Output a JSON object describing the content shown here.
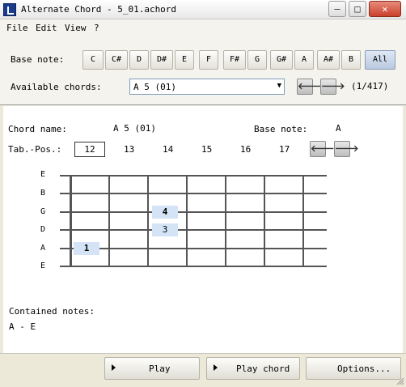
{
  "window": {
    "title": "Alternate Chord - 5_01.achord"
  },
  "menu": [
    "File",
    "Edit",
    "View",
    "?"
  ],
  "base_note": {
    "label": "Base note:",
    "notes": [
      "C",
      "C#",
      "D",
      "D#",
      "E",
      "F",
      "F#",
      "G",
      "G#",
      "A",
      "A#",
      "B"
    ],
    "all_label": "All"
  },
  "available": {
    "label": "Available chords:",
    "selected": "A 5 (01)",
    "counter": "(1/417)"
  },
  "chord": {
    "name_label": "Chord name:",
    "name_value": "A 5 (01)",
    "base_label": "Base note:",
    "base_value": "A",
    "tabpos_label": "Tab.-Pos.:",
    "positions": [
      "12",
      "13",
      "14",
      "15",
      "16",
      "17"
    ]
  },
  "strings": [
    "E",
    "B",
    "G",
    "D",
    "A",
    "E"
  ],
  "markers": [
    {
      "string": "A",
      "finger": "1"
    },
    {
      "string": "D",
      "finger": "3"
    },
    {
      "string": "G",
      "finger": "4"
    }
  ],
  "contained": {
    "label": "Contained notes:",
    "value": "A - E"
  },
  "buttons": {
    "play": "Play",
    "play_chord": "Play chord",
    "options": "Options..."
  }
}
